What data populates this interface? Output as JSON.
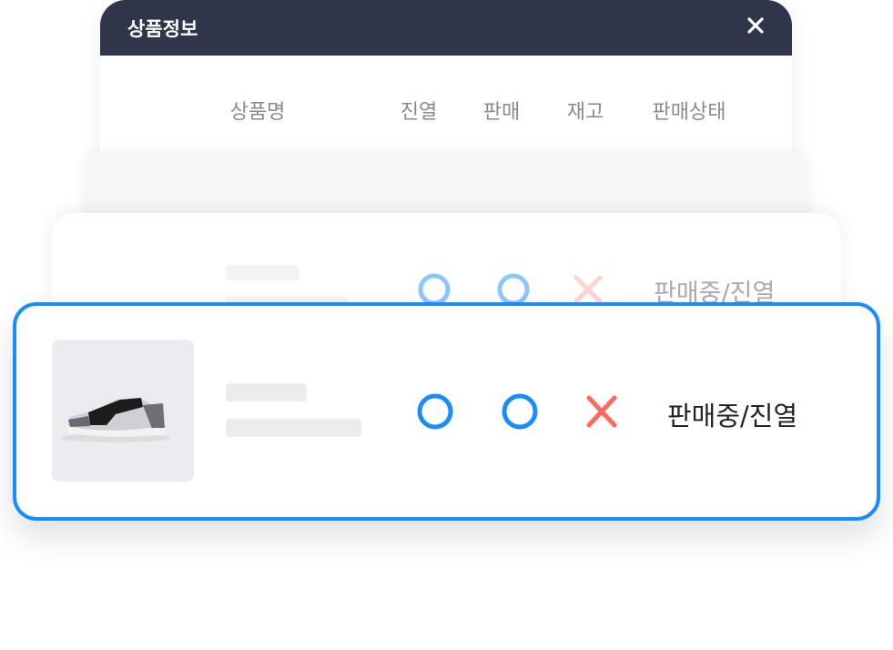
{
  "modal": {
    "title": "상품정보",
    "close_icon": "close-icon",
    "header_color": "#2f3649"
  },
  "table": {
    "columns": [
      "상품명",
      "진열",
      "판매",
      "재고",
      "판매상태"
    ]
  },
  "rows": [
    {
      "display": "O",
      "sale": "O",
      "stock": "X",
      "status": "판매중/진열",
      "faded": true
    },
    {
      "display": "O",
      "sale": "O",
      "stock": "X",
      "status": "판매중/진열",
      "faded": false,
      "selected": true,
      "image": "sneaker-product-image"
    }
  ],
  "colors": {
    "accent": "#1a8cff",
    "circle_faded": "#8cc6ff",
    "cross": "#ff6b5e",
    "cross_faded": "#ffd3d0"
  }
}
